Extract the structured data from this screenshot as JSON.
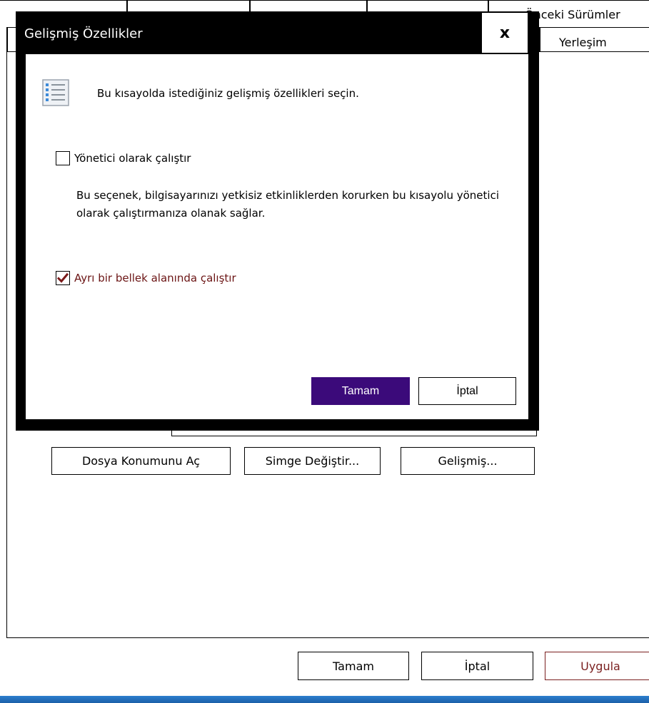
{
  "background_window": {
    "tabs_row1": [
      "Önceki Sürümler"
    ],
    "tabs_row2": [
      "Yerleşim"
    ],
    "panel_buttons": {
      "open_location": "Dosya Konumunu Aç",
      "change_icon": "Simge Değiştir...",
      "advanced": "Gelişmiş..."
    },
    "footer_buttons": {
      "ok": "Tamam",
      "cancel": "İptal",
      "apply": "Uygula"
    }
  },
  "dialog": {
    "title": "Gelişmiş Özellikler",
    "close_glyph": "x",
    "header_text": "Bu kısayolda istediğiniz gelişmiş özellikleri seçin.",
    "options": [
      {
        "label": "Yönetici olarak çalıştır",
        "checked": false,
        "description": "Bu seçenek, bilgisayarınızı yetkisiz etkinliklerden korurken bu kısayolu yönetici olarak çalıştırmanıza olanak sağlar."
      },
      {
        "label": "Ayrı bir bellek alanında çalıştır",
        "checked": true
      }
    ],
    "buttons": {
      "ok": "Tamam",
      "cancel": "İptal"
    }
  },
  "colors": {
    "ok_button_bg": "#3b0a7a",
    "checked_label": "#6b1414",
    "apply_border": "#7a1f1f",
    "dialog_frame": "#000000"
  }
}
